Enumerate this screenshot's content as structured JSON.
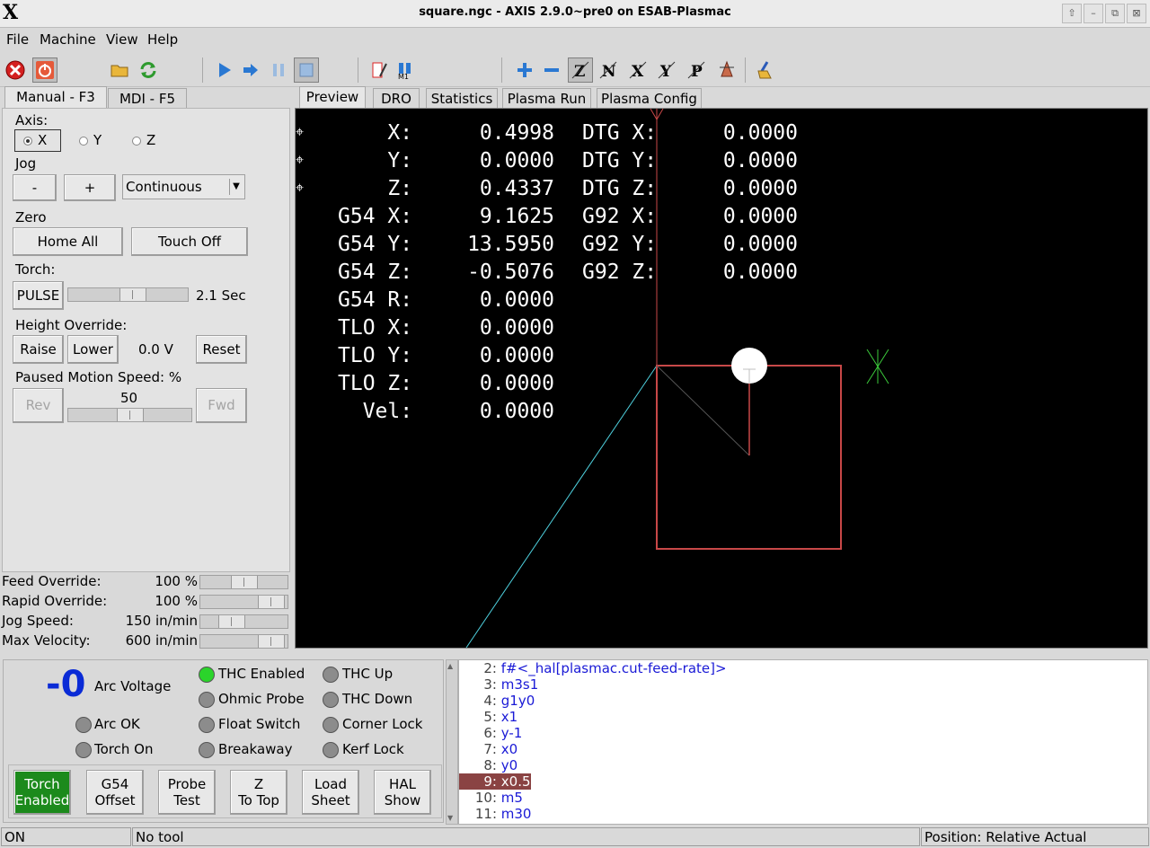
{
  "window": {
    "title": "square.ngc - AXIS 2.9.0~pre0 on ESAB-Plasmac",
    "logo": "X",
    "controls": [
      "⇧",
      "–",
      "⧉",
      "⊠"
    ]
  },
  "menu": [
    {
      "label": "File",
      "name": "menu-file"
    },
    {
      "label": "Machine",
      "name": "menu-machine"
    },
    {
      "label": "View",
      "name": "menu-view"
    },
    {
      "label": "Help",
      "name": "menu-help"
    }
  ],
  "toolbar": {
    "icons": [
      "estop-icon",
      "machine-power-icon",
      "open-file-icon",
      "reload-icon",
      "run-icon",
      "step-icon",
      "pause-icon",
      "stop-icon",
      "blockdelete-icon",
      "optional-stop-icon",
      "zoom-in-icon",
      "zoom-out-icon",
      "view-z-icon",
      "view-z2-icon",
      "view-x-icon",
      "view-y-icon",
      "view-p-icon",
      "rotated-view-icon",
      "clear-plot-icon"
    ],
    "view_labels": {
      "z": "Z",
      "z2": "N",
      "x": "X",
      "y": "Y",
      "p": "P"
    }
  },
  "left_tabs": [
    {
      "label": "Manual - F3",
      "active": true
    },
    {
      "label": "MDI - F5",
      "active": false
    }
  ],
  "manual": {
    "axis_label": "Axis:",
    "axes": [
      {
        "label": "X",
        "selected": true
      },
      {
        "label": "Y",
        "selected": false
      },
      {
        "label": "Z",
        "selected": false
      }
    ],
    "jog_label": "Jog",
    "jog_minus": "-",
    "jog_plus": "+",
    "jog_mode": "Continuous",
    "zero_label": "Zero",
    "home_all": "Home All",
    "touch_off": "Touch Off",
    "torch_label": "Torch:",
    "pulse": "PULSE",
    "pulse_time": "2.1 Sec",
    "pulse_level": 0.55,
    "height_label": "Height Override:",
    "raise": "Raise",
    "lower": "Lower",
    "height_value": "0.0 V",
    "reset": "Reset",
    "paused_label": "Paused Motion Speed: %",
    "rev": "Rev",
    "paused_value": "50",
    "fwd": "Fwd",
    "paused_level": 0.5
  },
  "overrides": [
    {
      "label": "Feed Override:",
      "value": "100",
      "unit": "%",
      "level": 0.5
    },
    {
      "label": "Rapid Override:",
      "value": "100",
      "unit": "%",
      "level": 0.95
    },
    {
      "label": "Jog Speed:",
      "value": "150",
      "unit": "in/min",
      "level": 0.3
    },
    {
      "label": "Max Velocity:",
      "value": "600",
      "unit": "in/min",
      "level": 0.95
    }
  ],
  "right_tabs": [
    {
      "label": "Preview",
      "active": true
    },
    {
      "label": "DRO",
      "active": false
    },
    {
      "label": "Statistics",
      "active": false
    },
    {
      "label": "Plasma Run",
      "active": false
    },
    {
      "label": "Plasma Config",
      "active": false
    }
  ],
  "dro": {
    "left": [
      {
        "label": "    X:",
        "value": "0.4998"
      },
      {
        "label": "    Y:",
        "value": "0.0000"
      },
      {
        "label": "    Z:",
        "value": "0.4337"
      },
      {
        "label": "G54 X:",
        "value": "9.1625"
      },
      {
        "label": "G54 Y:",
        "value": "13.5950"
      },
      {
        "label": "G54 Z:",
        "value": "-0.5076"
      },
      {
        "label": "G54 R:",
        "value": "0.0000"
      },
      {
        "label": "TLO X:",
        "value": "0.0000"
      },
      {
        "label": "TLO Y:",
        "value": "0.0000"
      },
      {
        "label": "TLO Z:",
        "value": "0.0000"
      },
      {
        "label": "  Vel:",
        "value": "0.0000"
      }
    ],
    "right": [
      {
        "label": "DTG X:",
        "value": "0.0000"
      },
      {
        "label": "DTG Y:",
        "value": "0.0000"
      },
      {
        "label": "DTG Z:",
        "value": "0.0000"
      },
      {
        "label": "G92 X:",
        "value": "0.0000"
      },
      {
        "label": "G92 Y:",
        "value": "0.0000"
      },
      {
        "label": "G92 Z:",
        "value": "0.0000"
      }
    ],
    "home_marker": "⌖"
  },
  "plasma": {
    "arc_voltage_value": "-0",
    "arc_voltage_label": "Arc Voltage",
    "leds": [
      {
        "label": "Arc OK",
        "on": false
      },
      {
        "label": "Torch On",
        "on": false
      },
      {
        "label": "THC Enabled",
        "on": true
      },
      {
        "label": "Ohmic Probe",
        "on": false
      },
      {
        "label": "Float Switch",
        "on": false
      },
      {
        "label": "Breakaway",
        "on": false
      },
      {
        "label": "THC Up",
        "on": false
      },
      {
        "label": "THC Down",
        "on": false
      },
      {
        "label": "Corner Lock",
        "on": false
      },
      {
        "label": "Kerf Lock",
        "on": false
      }
    ],
    "buttons": [
      {
        "line1": "Torch",
        "line2": "Enabled",
        "active": true
      },
      {
        "line1": "G54",
        "line2": "Offset",
        "active": false
      },
      {
        "line1": "Probe",
        "line2": "Test",
        "active": false
      },
      {
        "line1": "Z",
        "line2": "To Top",
        "active": false
      },
      {
        "line1": "Load",
        "line2": "Sheet",
        "active": false
      },
      {
        "line1": "HAL",
        "line2": "Show",
        "active": false
      }
    ]
  },
  "gcode": [
    {
      "num": "2:",
      "text": "f#<_hal[plasmac.cut-feed-rate]>",
      "selected": false
    },
    {
      "num": "3:",
      "text": "m3s1",
      "selected": false
    },
    {
      "num": "4:",
      "text": "g1y0",
      "selected": false
    },
    {
      "num": "5:",
      "text": "x1",
      "selected": false
    },
    {
      "num": "6:",
      "text": "y-1",
      "selected": false
    },
    {
      "num": "7:",
      "text": "x0",
      "selected": false
    },
    {
      "num": "8:",
      "text": "y0",
      "selected": false
    },
    {
      "num": "9:",
      "text": "x0.5",
      "selected": true
    },
    {
      "num": "10:",
      "text": "m5",
      "selected": false
    },
    {
      "num": "11:",
      "text": "m30",
      "selected": false
    }
  ],
  "status": {
    "machine": "ON",
    "tool": "No tool",
    "position": "Position: Relative Actual"
  },
  "colors": {
    "path_red": "#c84848",
    "rapid_cyan": "#4fd2e0",
    "tool_white": "#ffffff",
    "origin_green": "#3ccc3c",
    "gcode_blue": "#1a1ad6",
    "led_green": "#2bd42b",
    "torch_green": "#1c8a1c",
    "arc_blue": "#0a2bd6"
  }
}
